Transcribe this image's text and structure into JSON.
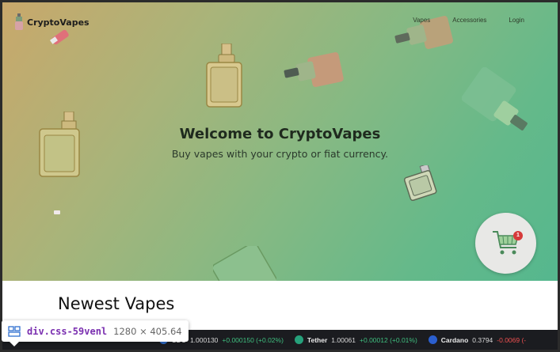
{
  "brand": {
    "name": "CryptoVapes"
  },
  "nav": {
    "items": [
      "Vapes",
      "Accessories",
      "Login"
    ]
  },
  "hero": {
    "title": "Welcome to CryptoVapes",
    "subtitle": "Buy vapes with your crypto or fiat currency."
  },
  "cart": {
    "count": "1"
  },
  "section": {
    "title": "Newest Vapes"
  },
  "ticker": [
    {
      "name": "SDC",
      "price": "1.000130",
      "change": "+0.000150 (+0.02%)",
      "direction": "up",
      "icon": "usdc-coin-icon"
    },
    {
      "name": "Tether",
      "price": "1.00061",
      "change": "+0.00012 (+0.01%)",
      "direction": "up",
      "icon": "tether-coin-icon"
    },
    {
      "name": "Cardano",
      "price": "0.3794",
      "change": "-0.0069 (-",
      "direction": "down",
      "icon": "cardano-coin-icon"
    }
  ],
  "inspector": {
    "selector": "div.css-59venl",
    "size": "1280 × 405.64"
  },
  "colors": {
    "hero_start": "#c9a86b",
    "hero_end": "#55b78e",
    "badge": "#d63a3a",
    "ticker_bg": "#1b1c20"
  }
}
